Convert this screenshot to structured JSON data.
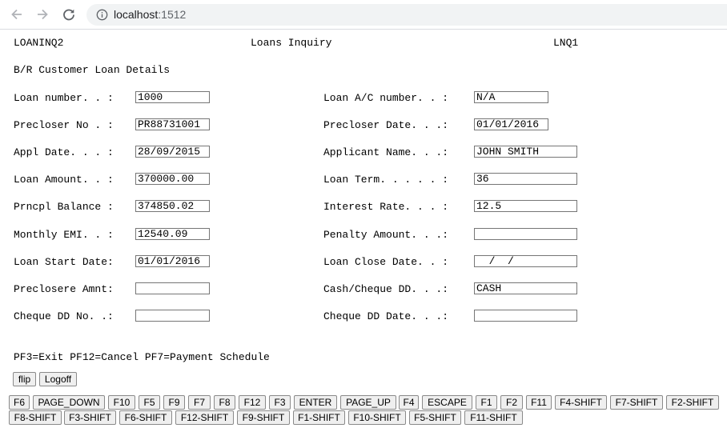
{
  "browser": {
    "url_host": "localhost",
    "url_port": ":1512"
  },
  "screen": {
    "program_id": "LOANINQ2",
    "title": "Loans Inquiry",
    "screen_id": "LNQ1",
    "subtitle": "B/R Customer Loan Details",
    "labels": {
      "loan_number": "Loan number. . :",
      "loan_ac_number": "Loan A/C number. . :",
      "precloser_no": "Precloser No . :",
      "precloser_date": "Precloser Date. . .:",
      "appl_date": "Appl Date. . . :",
      "applicant_name": "Applicant Name. . .:",
      "loan_amount": "Loan Amount. . :",
      "loan_term": "Loan Term. . . . . :",
      "prncpl_balance": "Prncpl Balance :",
      "interest_rate": "Interest Rate. . . :",
      "monthly_emi": "Monthly EMI. . :",
      "penalty_amount": "Penalty Amount. . .:",
      "loan_start_date": "Loan Start Date:",
      "loan_close_date": "Loan Close Date. . :",
      "preclosere_amnt": "Preclosere Amnt:",
      "cash_cheque_dd": "Cash/Cheque DD. . .:",
      "cheque_dd_no": "Cheque DD No. .:",
      "cheque_dd_date": "Cheque DD Date. . .:"
    },
    "values": {
      "loan_number": "1000",
      "loan_ac_number": "N/A",
      "precloser_no": "PR88731001",
      "precloser_date": "01/01/2016",
      "appl_date": "28/09/2015",
      "applicant_name": "JOHN SMITH",
      "loan_amount": "370000.00",
      "loan_term": "36",
      "prncpl_balance": "374850.02",
      "interest_rate": "12.5",
      "monthly_emi": "12540.09",
      "penalty_amount": "",
      "loan_start_date": "01/01/2016",
      "loan_close_date": "  /  /",
      "preclosere_amnt": "",
      "cash_cheque_dd": "CASH",
      "cheque_dd_no": "",
      "cheque_dd_date": ""
    },
    "function_keys_help": "PF3=Exit PF12=Cancel PF7=Payment Schedule"
  },
  "controls": {
    "flip": "flip",
    "logoff": "Logoff"
  },
  "key_buttons": [
    "F6",
    "PAGE_DOWN",
    "F10",
    "F5",
    "F9",
    "F7",
    "F8",
    "F12",
    "F3",
    "ENTER",
    "PAGE_UP",
    "F4",
    "ESCAPE",
    "F1",
    "F2",
    "F11",
    "F4-SHIFT",
    "F7-SHIFT",
    "F2-SHIFT",
    "F8-SHIFT",
    "F3-SHIFT",
    "F6-SHIFT",
    "F12-SHIFT",
    "F9-SHIFT",
    "F1-SHIFT",
    "F10-SHIFT",
    "F5-SHIFT",
    "F11-SHIFT"
  ]
}
